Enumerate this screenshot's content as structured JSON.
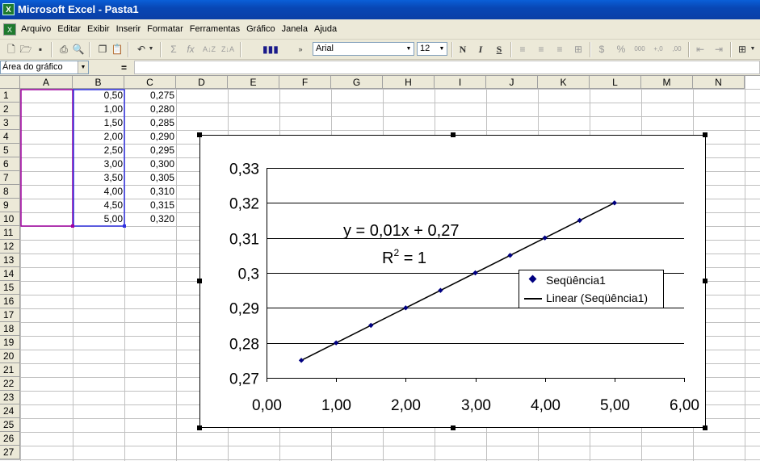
{
  "window": {
    "title": "Microsoft Excel - Pasta1"
  },
  "menu": [
    "Arquivo",
    "Editar",
    "Exibir",
    "Inserir",
    "Formatar",
    "Ferramentas",
    "Gráfico",
    "Janela",
    "Ajuda"
  ],
  "toolbar": {
    "font": "Arial",
    "size": "12",
    "bold": "N",
    "italic": "I",
    "underline": "S"
  },
  "formula_bar": {
    "name_box": "Área do gráfico",
    "equals": "="
  },
  "columns": [
    "A",
    "B",
    "C",
    "D",
    "E",
    "F",
    "G",
    "H",
    "I",
    "J",
    "K",
    "L",
    "M",
    "N"
  ],
  "rows": [
    "1",
    "2",
    "3",
    "4",
    "5",
    "6",
    "7",
    "8",
    "9",
    "10",
    "11",
    "12",
    "13",
    "14",
    "15",
    "16",
    "17",
    "18",
    "19",
    "20",
    "21",
    "22",
    "23",
    "24",
    "25",
    "26",
    "27"
  ],
  "cells": {
    "A": [
      "0,50",
      "1,00",
      "1,50",
      "2,00",
      "2,50",
      "3,00",
      "3,50",
      "4,00",
      "4,50",
      "5,00"
    ],
    "B": [
      "0,275",
      "0,280",
      "0,285",
      "0,290",
      "0,295",
      "0,300",
      "0,305",
      "0,310",
      "0,315",
      "0,320"
    ]
  },
  "chart_data": {
    "type": "scatter",
    "x": [
      0.5,
      1.0,
      1.5,
      2.0,
      2.5,
      3.0,
      3.5,
      4.0,
      4.5,
      5.0
    ],
    "series": [
      {
        "name": "Seqüência1",
        "values": [
          0.275,
          0.28,
          0.285,
          0.29,
          0.295,
          0.3,
          0.305,
          0.31,
          0.315,
          0.32
        ]
      }
    ],
    "trendline": {
      "name": "Linear (Seqüência1)",
      "slope": 0.01,
      "intercept": 0.27
    },
    "equation": "y = 0,01x + 0,27",
    "r2_label": "R",
    "r2_exp": "2",
    "r2_value": " = 1",
    "xlim": [
      0,
      6
    ],
    "ylim": [
      0.27,
      0.33
    ],
    "x_ticks": [
      "0,00",
      "1,00",
      "2,00",
      "3,00",
      "4,00",
      "5,00",
      "6,00"
    ],
    "y_ticks": [
      "0,27",
      "0,28",
      "0,29",
      "0,3",
      "0,31",
      "0,32",
      "0,33"
    ],
    "grid": "horizontal",
    "legend_position": "right",
    "colors": {
      "marker": "#000080",
      "line": "#000000"
    }
  }
}
